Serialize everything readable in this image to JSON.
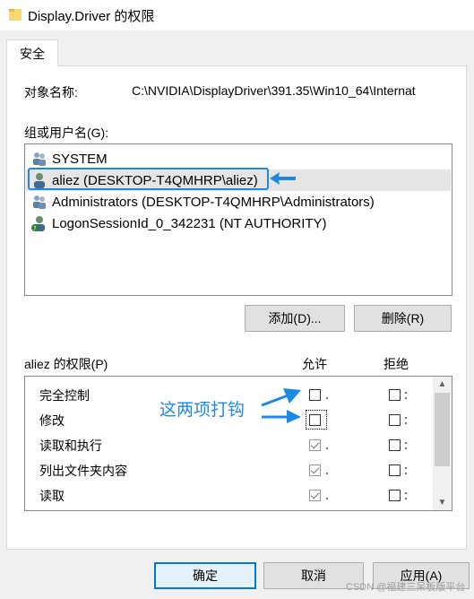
{
  "window": {
    "title": "Display.Driver 的权限"
  },
  "tabs": [
    {
      "label": "安全"
    }
  ],
  "object": {
    "label": "对象名称:",
    "value": "C:\\NVIDIA\\DisplayDriver\\391.35\\Win10_64\\Internat"
  },
  "groups": {
    "label": "组或用户名(G):",
    "items": [
      {
        "name": "SYSTEM",
        "icon": "users-group-icon"
      },
      {
        "name": "aliez (DESKTOP-T4QMHRP\\aliez)",
        "icon": "user-icon",
        "selected": true
      },
      {
        "name": "Administrators (DESKTOP-T4QMHRP\\Administrators)",
        "icon": "users-group-icon"
      },
      {
        "name": "LogonSessionId_0_342231 (NT AUTHORITY)",
        "icon": "user-question-icon"
      }
    ]
  },
  "buttons": {
    "add": "添加(D)...",
    "remove": "删除(R)",
    "ok": "确定",
    "cancel": "取消",
    "apply": "应用(A)"
  },
  "permissions": {
    "label": "aliez 的权限(P)",
    "allow_header": "允许",
    "deny_header": "拒绝",
    "rows": [
      {
        "name": "完全控制",
        "allow": false,
        "deny": false
      },
      {
        "name": "修改",
        "allow": false,
        "deny": false
      },
      {
        "name": "读取和执行",
        "allow": true,
        "deny": false
      },
      {
        "name": "列出文件夹内容",
        "allow": true,
        "deny": false
      },
      {
        "name": "读取",
        "allow": true,
        "deny": false
      }
    ]
  },
  "annotation": {
    "text": "这两项打钩",
    "color": "#1e88e5"
  },
  "watermark": "CSDN @福建三呆板版平台"
}
